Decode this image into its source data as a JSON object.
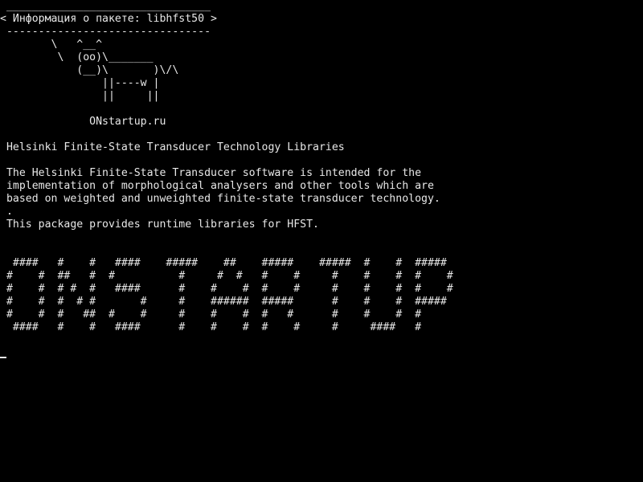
{
  "terminal": {
    "colors": {
      "background": "#000000",
      "foreground": "#e8e8e8"
    },
    "cowsay": {
      "border_top": " ________________________________",
      "message": "< Информация о пакете: libhfst50 >",
      "border_bottom": " --------------------------------",
      "cow": [
        "        \\   ^__^",
        "         \\  (oo)\\_______",
        "            (__)\\       )\\/\\",
        "                ||----w |",
        "                ||     ||"
      ],
      "site": "              ONstartup.ru"
    },
    "package": {
      "title": " Helsinki Finite-State Transducer Technology Libraries",
      "description": [
        " The Helsinki Finite-State Transducer software is intended for the",
        " implementation of morphological analysers and other tools which are",
        " based on weighted and unweighted finite-state transducer technology.",
        " .",
        " This package provides runtime libraries for HFST."
      ]
    },
    "banner": [
      "  ####   #    #   ####    #####    ##    #####    #####  #    #  #####",
      " #    #  ##   #  #          #     #  #   #    #     #    #    #  #    #",
      " #    #  # #  #   ####      #    #    #  #    #     #    #    #  #    #",
      " #    #  #  # #       #     #    ######  #####      #    #    #  #####",
      " #    #  #   ##  #    #     #    #    #  #   #      #    #    #  #",
      "  ####   #    #   ####      #    #    #  #    #     #     ####   #"
    ]
  }
}
